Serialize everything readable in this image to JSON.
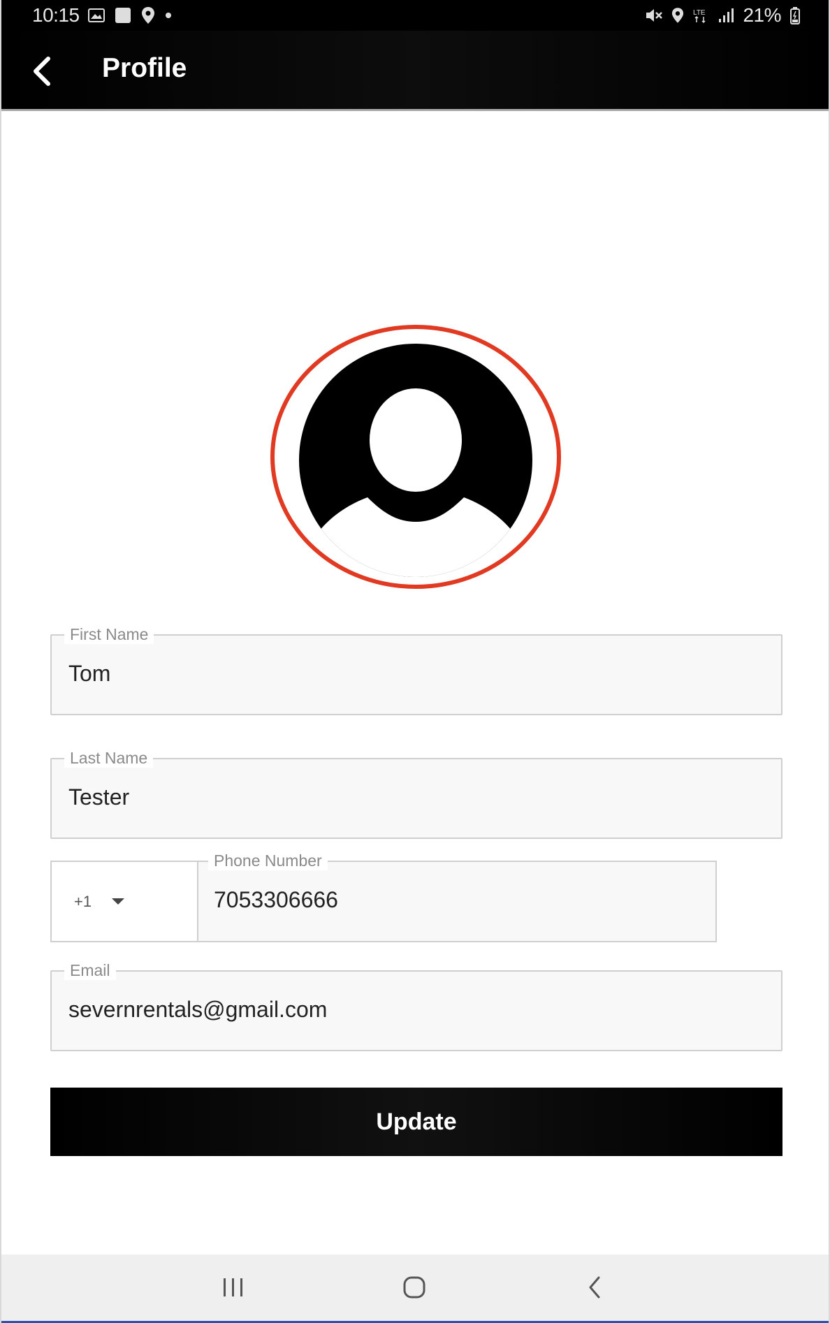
{
  "status_bar": {
    "time": "10:15",
    "battery": "21%",
    "icons": [
      "gallery-icon",
      "square-notification-icon",
      "location-icon",
      "dot-icon",
      "mute-icon",
      "location-icon",
      "lte-icon",
      "signal-icon",
      "battery-icon"
    ]
  },
  "app_bar": {
    "title": "Profile",
    "back_icon": "chevron-left-icon"
  },
  "avatar": {
    "icon": "user-avatar-icon",
    "highlight_color": "#e03a22"
  },
  "form": {
    "first_name": {
      "label": "First Name",
      "value": "Tom"
    },
    "last_name": {
      "label": "Last Name",
      "value": "Tester"
    },
    "phone": {
      "country_code": "+1",
      "label": "Phone Number",
      "value": "7053306666"
    },
    "email": {
      "label": "Email",
      "value": "severnrentals@gmail.com"
    }
  },
  "update_button": {
    "label": "Update"
  },
  "nav_bar": {
    "recents_icon": "recents-icon",
    "home_icon": "home-icon",
    "back_icon": "back-icon"
  },
  "colors": {
    "app_bar_bg": "#000000",
    "button_bg": "#000000",
    "nav_accent": "#2f4fa8"
  }
}
